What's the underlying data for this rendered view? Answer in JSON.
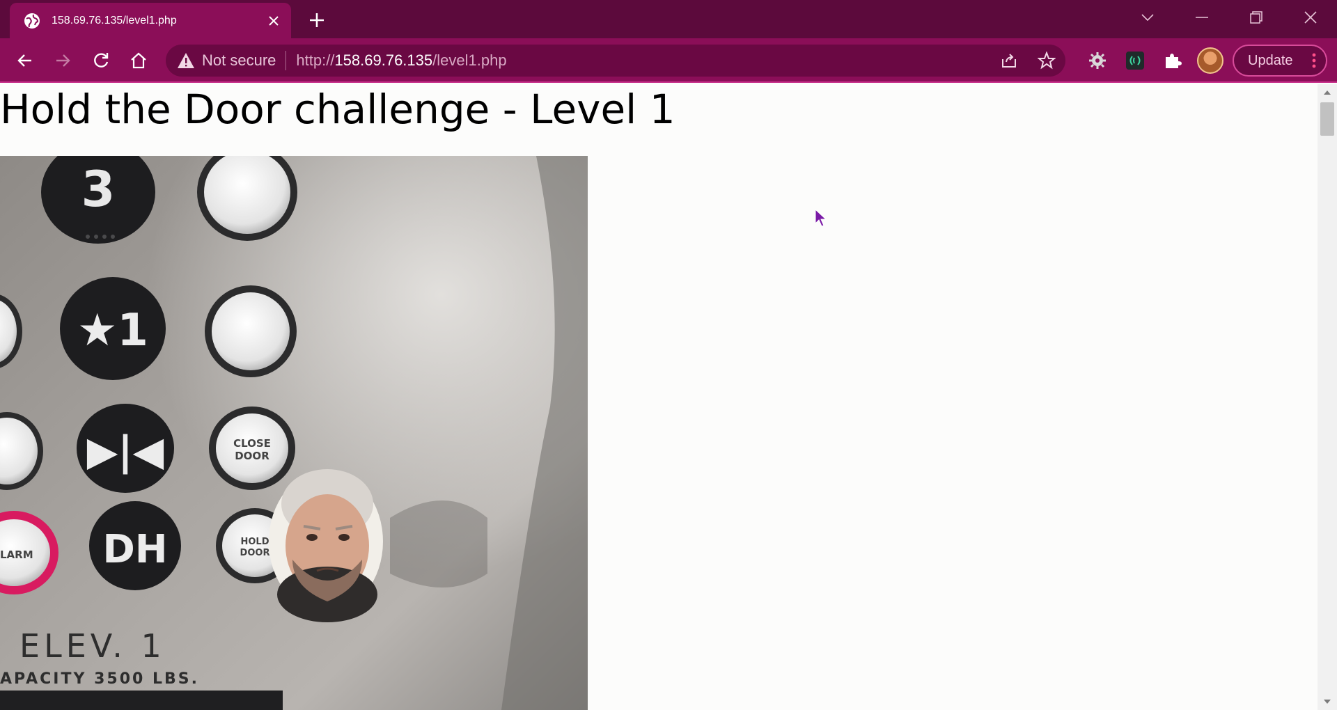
{
  "browser": {
    "tab_title": "158.69.76.135/level1.php",
    "security_label": "Not secure",
    "url_scheme": "http://",
    "url_host": "158.69.76.135",
    "url_path": "/level1.php",
    "update_label": "Update",
    "colors": {
      "frame": "#5c0a3c",
      "toolbar": "#8b0e58",
      "omnibox": "#6a0843"
    }
  },
  "page": {
    "title": "Hold the Door challenge - Level 1",
    "image": {
      "buttons": [
        {
          "label": "3"
        },
        {
          "label": "★1"
        },
        {
          "label": "▶|◀"
        },
        {
          "label": "CLOSE\nDOOR"
        },
        {
          "label": "DH"
        },
        {
          "label": "HOLD\nDOOR"
        },
        {
          "label": "ALARM"
        }
      ],
      "plate_line1": "ELEV. 1",
      "plate_line2": "APACITY 3500 LBS."
    }
  }
}
